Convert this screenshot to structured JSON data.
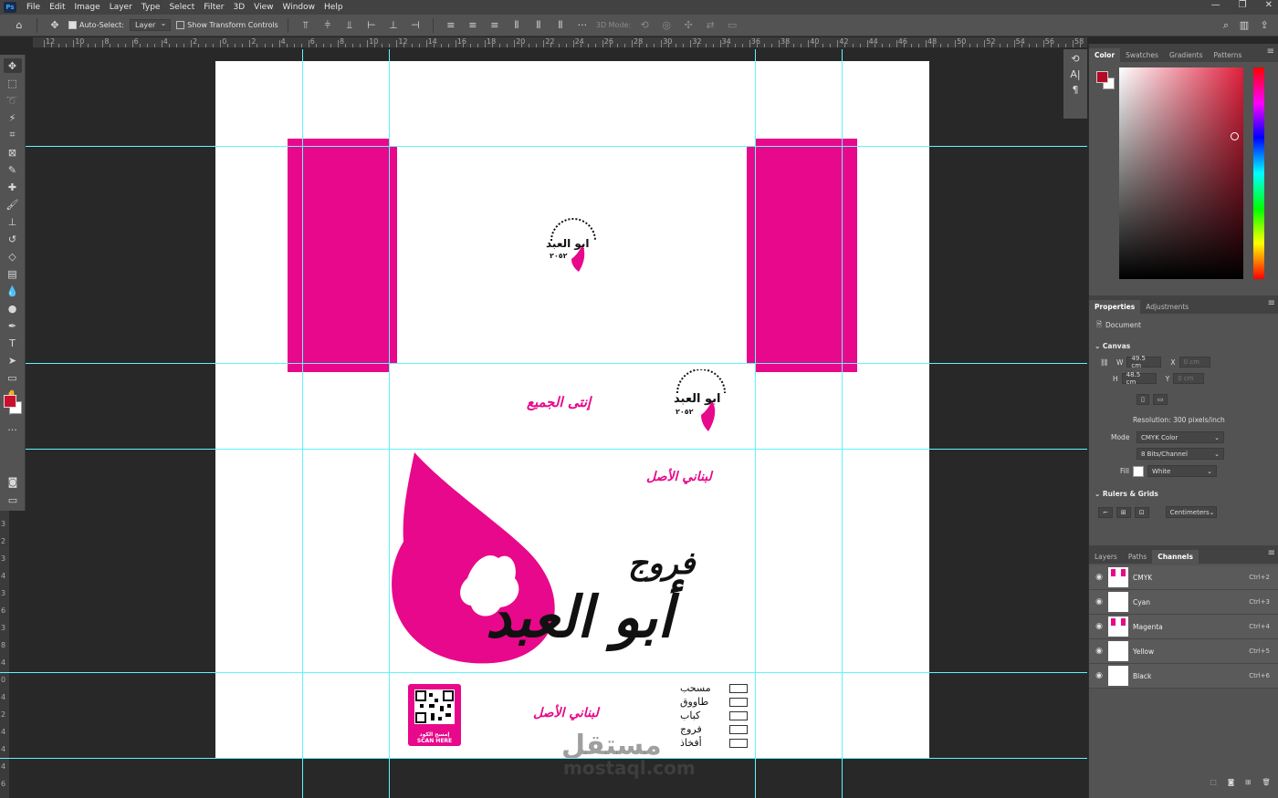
{
  "menubar": {
    "app_icon": "Ps",
    "items": [
      "File",
      "Edit",
      "Image",
      "Layer",
      "Type",
      "Select",
      "Filter",
      "3D",
      "View",
      "Window",
      "Help"
    ],
    "window_controls": [
      "—",
      "❐",
      "✕"
    ]
  },
  "options": {
    "auto_select_label": "Auto-Select:",
    "auto_select_value": "Layer",
    "transform_label": "Show Transform Controls",
    "mode_3d_label": "3D Mode:"
  },
  "ruler": {
    "top_labels": [
      "12",
      "10",
      "8",
      "6",
      "4",
      "2",
      "0",
      "2",
      "4",
      "6",
      "8",
      "10",
      "12",
      "14",
      "16",
      "18",
      "20",
      "22",
      "24",
      "26",
      "28",
      "30",
      "32",
      "34",
      "36",
      "38",
      "40",
      "42",
      "44",
      "46",
      "48",
      "50",
      "52",
      "54",
      "56",
      "58"
    ],
    "left_labels": [
      "3",
      "2",
      "3",
      "4",
      "3",
      "6",
      "3",
      "8",
      "4",
      "0",
      "4",
      "2",
      "4",
      "4",
      "4",
      "6"
    ]
  },
  "document": {
    "top_logo_text": "ابو العبد",
    "top_logo_sub": "٢٠٥٢",
    "tagline_1": "إنتى الجميع",
    "tagline_2": "لبناني الأصل",
    "tagline_3": "لبناني الأصل",
    "brand_line1": "فروج",
    "brand_line2": "أبو العبد",
    "menu_items": [
      "مسحب",
      "طاووق",
      "كباب",
      "فروج",
      "أفخاذ"
    ],
    "qr_ar": "إمسح الكود",
    "qr_en": "SCAN HERE",
    "watermark": "مستقل",
    "watermark_url": "mostaql.com"
  },
  "color_panel": {
    "tabs": [
      "Color",
      "Swatches",
      "Gradients",
      "Patterns"
    ],
    "active_tab": "Color",
    "foreground": "#b30a25",
    "background": "#ffffff"
  },
  "properties": {
    "tabs": [
      "Properties",
      "Adjustments"
    ],
    "active_tab": "Properties",
    "doc_label": "Document",
    "canvas_label": "Canvas",
    "w_label": "W",
    "w_value": "49.5 cm",
    "h_label": "H",
    "h_value": "48.5 cm",
    "x_label": "X",
    "x_value": "0 cm",
    "y_label": "Y",
    "y_value": "0 cm",
    "resolution": "Resolution: 300 pixels/inch",
    "mode_label": "Mode",
    "mode_value": "CMYK Color",
    "bits_value": "8 Bits/Channel",
    "fill_label": "Fill",
    "fill_value": "White",
    "rulers_label": "Rulers & Grids",
    "units_value": "Centimeters"
  },
  "channels": {
    "tabs": [
      "Layers",
      "Paths",
      "Channels"
    ],
    "active_tab": "Channels",
    "rows": [
      {
        "name": "CMYK",
        "key": "Ctrl+2"
      },
      {
        "name": "Cyan",
        "key": "Ctrl+3"
      },
      {
        "name": "Magenta",
        "key": "Ctrl+4"
      },
      {
        "name": "Yellow",
        "key": "Ctrl+5"
      },
      {
        "name": "Black",
        "key": "Ctrl+6"
      }
    ]
  },
  "colors": {
    "brand_pink": "#e8088b",
    "guide": "#5ff5ff"
  }
}
